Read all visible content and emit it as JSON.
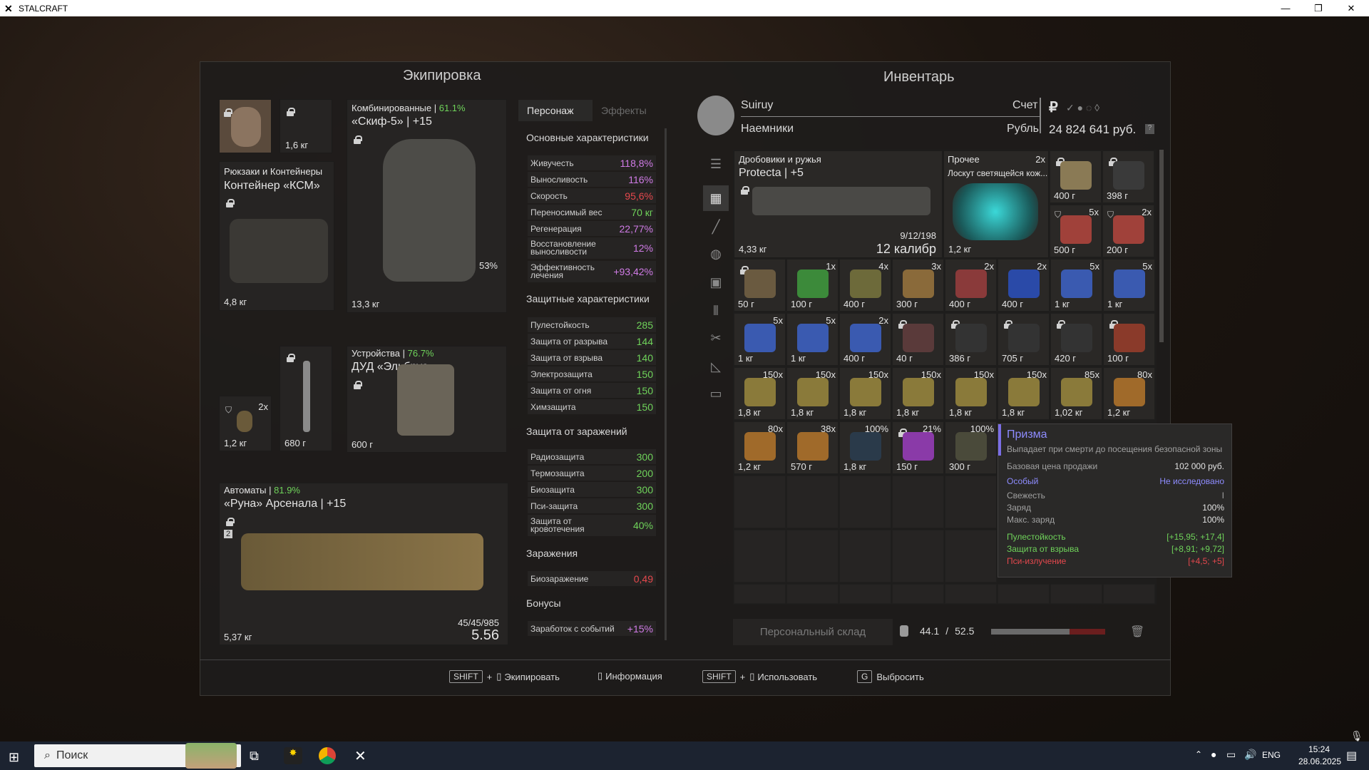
{
  "window": {
    "title": "STALCRAFT",
    "minimize": "—",
    "maximize": "❐",
    "close": "✕"
  },
  "equipment": {
    "title": "Экипировка",
    "portrait_weight": "1,6 кг",
    "backpack": {
      "category": "Рюкзаки и Контейнеры",
      "name": "Контейнер «КСМ»",
      "weight": "4,8 кг"
    },
    "armor": {
      "category": "Комбинированные",
      "quality": "61.1%",
      "name": "«Скиф-5»",
      "upgrade": "+15",
      "weight": "13,3 кг",
      "durability": "53%"
    },
    "grenade": {
      "count": "2x",
      "weight": "1,2 кг"
    },
    "knife": {
      "weight": "680 г"
    },
    "device": {
      "category": "Устройства",
      "quality": "76.7%",
      "name": "ДУД «Эльбрус»",
      "weight": "600 г"
    },
    "rifle": {
      "category": "Автоматы",
      "quality": "81.9%",
      "name": "«Руна» Арсенала",
      "upgrade": "+15",
      "weight": "5,37 кг",
      "ammo": "45/45/985",
      "caliber": "5.56",
      "slot_num": "2"
    }
  },
  "stats": {
    "tabs": [
      "Персонаж",
      "Эффекты"
    ],
    "main_title": "Основные характеристики",
    "main": [
      {
        "label": "Живучесть",
        "value": "118,8%",
        "color": "purple"
      },
      {
        "label": "Выносливость",
        "value": "116%",
        "color": "purple"
      },
      {
        "label": "Скорость",
        "value": "95,6%",
        "color": "red"
      },
      {
        "label": "Переносимый вес",
        "value": "70 кг",
        "color": "green"
      },
      {
        "label": "Регенерация",
        "value": "22,77%",
        "color": "purple"
      },
      {
        "label": "Восстановление выносливости",
        "value": "12%",
        "color": "purple"
      },
      {
        "label": "Эффективность лечения",
        "value": "+93,42%",
        "color": "purple"
      }
    ],
    "defense_title": "Защитные характеристики",
    "defense": [
      {
        "label": "Пулестойкость",
        "value": "285"
      },
      {
        "label": "Защита от разрыва",
        "value": "144"
      },
      {
        "label": "Защита от взрыва",
        "value": "140"
      },
      {
        "label": "Электрозащита",
        "value": "150"
      },
      {
        "label": "Защита от огня",
        "value": "150"
      },
      {
        "label": "Химзащита",
        "value": "150"
      }
    ],
    "infection_def_title": "Защита от заражений",
    "infection_def": [
      {
        "label": "Радиозащита",
        "value": "300"
      },
      {
        "label": "Термозащита",
        "value": "200"
      },
      {
        "label": "Биозащита",
        "value": "300"
      },
      {
        "label": "Пси-защита",
        "value": "300"
      },
      {
        "label": "Защита от кровотечения",
        "value": "40%"
      }
    ],
    "infection_title": "Заражения",
    "infection": [
      {
        "label": "Биозаражение",
        "value": "0,49"
      }
    ],
    "bonus_title": "Бонусы",
    "bonus": [
      {
        "label": "Заработок с событий",
        "value": "+15%"
      }
    ]
  },
  "inventory": {
    "title": "Инвентарь",
    "player": "Suiruy",
    "faction": "Наемники",
    "account_label": "Счет",
    "currency_label": "Рубль",
    "money": "24 824 641 руб.",
    "weapon": {
      "category": "Дробовики и ружья",
      "name": "Protecta",
      "upgrade": "+5",
      "weight": "4,33 кг",
      "ammo": "9/12/198",
      "caliber": "12 калибр"
    },
    "other": {
      "category": "Прочее",
      "count": "2x",
      "name": "Лоскут светящейся кож...",
      "weight": "1,2 кг"
    },
    "cells": [
      {
        "count": "",
        "weight": "400 г",
        "color": "#8a7a55",
        "locked": true
      },
      {
        "count": "",
        "weight": "398 г",
        "color": "#3a3a3a",
        "locked": true
      },
      {
        "count": "5x",
        "weight": "500 г",
        "color": "#a0413a",
        "locked": false
      },
      {
        "count": "2x",
        "weight": "200 г",
        "color": "#a0413a",
        "locked": false
      },
      {
        "count": "",
        "weight": "50 г",
        "color": "#6a5a40",
        "locked": true
      },
      {
        "count": "1x",
        "weight": "100 г",
        "color": "#3c8a3a",
        "locked": false
      },
      {
        "count": "4x",
        "weight": "400 г",
        "color": "#6d6a3a",
        "locked": false
      },
      {
        "count": "3x",
        "weight": "300 г",
        "color": "#8a6a3a",
        "locked": false
      },
      {
        "count": "2x",
        "weight": "400 г",
        "color": "#8a3a3a",
        "locked": false
      },
      {
        "count": "2x",
        "weight": "400 г",
        "color": "#2a4aa8",
        "locked": false
      },
      {
        "count": "5x",
        "weight": "1 кг",
        "color": "#3a5ab0",
        "locked": false
      },
      {
        "count": "5x",
        "weight": "1 кг",
        "color": "#3a5ab0",
        "locked": false
      },
      {
        "count": "5x",
        "weight": "1 кг",
        "color": "#3a5ab0",
        "locked": false
      },
      {
        "count": "5x",
        "weight": "1 кг",
        "color": "#3a5ab0",
        "locked": false
      },
      {
        "count": "2x",
        "weight": "400 г",
        "color": "#3a5ab0",
        "locked": false
      },
      {
        "count": "",
        "weight": "40 г",
        "color": "#5a3a3a",
        "locked": true
      },
      {
        "count": "",
        "weight": "386 г",
        "color": "#333",
        "locked": true
      },
      {
        "count": "",
        "weight": "705 г",
        "color": "#333",
        "locked": true
      },
      {
        "count": "",
        "weight": "420 г",
        "color": "#333",
        "locked": true
      },
      {
        "count": "",
        "weight": "100 г",
        "color": "#8a3a2a",
        "locked": true
      },
      {
        "count": "150x",
        "weight": "1,8 кг",
        "color": "#8a7a3a",
        "locked": false
      },
      {
        "count": "150x",
        "weight": "1,8 кг",
        "color": "#8a7a3a",
        "locked": false
      },
      {
        "count": "150x",
        "weight": "1,8 кг",
        "color": "#8a7a3a",
        "locked": false
      },
      {
        "count": "150x",
        "weight": "1,8 кг",
        "color": "#8a7a3a",
        "locked": false
      },
      {
        "count": "150x",
        "weight": "1,8 кг",
        "color": "#8a7a3a",
        "locked": false
      },
      {
        "count": "150x",
        "weight": "1,8 кг",
        "color": "#8a7a3a",
        "locked": false
      },
      {
        "count": "85x",
        "weight": "1,02 кг",
        "color": "#8a7a3a",
        "locked": false
      },
      {
        "count": "80x",
        "weight": "1,2 кг",
        "color": "#a06a2a",
        "locked": false
      },
      {
        "count": "80x",
        "weight": "1,2 кг",
        "color": "#a06a2a",
        "locked": false
      },
      {
        "count": "38x",
        "weight": "570 г",
        "color": "#a06a2a",
        "locked": false
      },
      {
        "count": "100%",
        "weight": "1,8 кг",
        "color": "#2a3a4a",
        "locked": false
      },
      {
        "count": "21%",
        "weight": "150 г",
        "color": "#8a3aa8",
        "locked": true
      },
      {
        "count": "100%",
        "weight": "300 г",
        "color": "#4a4a3a",
        "locked": false
      }
    ],
    "storage_label": "Персональный склад",
    "weight_current": "44.1",
    "weight_sep": "/",
    "weight_max": "52.5",
    "weight_fraction": 0.84
  },
  "tooltip": {
    "title": "Призма",
    "subtitle": "Выпадает при смерти до посещения безопасной зоны",
    "price_label": "Базовая цена продажи",
    "price": "102 000 руб.",
    "rarity": "Особый",
    "research": "Не исследовано",
    "freshness_label": "Свежесть",
    "freshness_value": "I",
    "charge_label": "Заряд",
    "charge_value": "100%",
    "max_charge_label": "Макс. заряд",
    "max_charge_value": "100%",
    "effects": [
      {
        "label": "Пулестойкость",
        "value": "[+15,95; +17,4]",
        "color": "green"
      },
      {
        "label": "Защита от взрыва",
        "value": "[+8,91; +9,72]",
        "color": "green"
      },
      {
        "label": "Пси-излучение",
        "value": "[+4,5; +5]",
        "color": "red"
      }
    ]
  },
  "hints": [
    {
      "key": "SHIFT",
      "plus": "+",
      "label": "Экипировать"
    },
    {
      "key": "",
      "plus": "",
      "label": "Информация"
    },
    {
      "key": "SHIFT",
      "plus": "+",
      "label": "Использовать"
    },
    {
      "key": "G",
      "plus": "",
      "label": "Выбросить"
    }
  ],
  "taskbar": {
    "search_placeholder": "Поиск",
    "lang": "ENG",
    "time": "15:24",
    "date": "28.06.2025"
  }
}
